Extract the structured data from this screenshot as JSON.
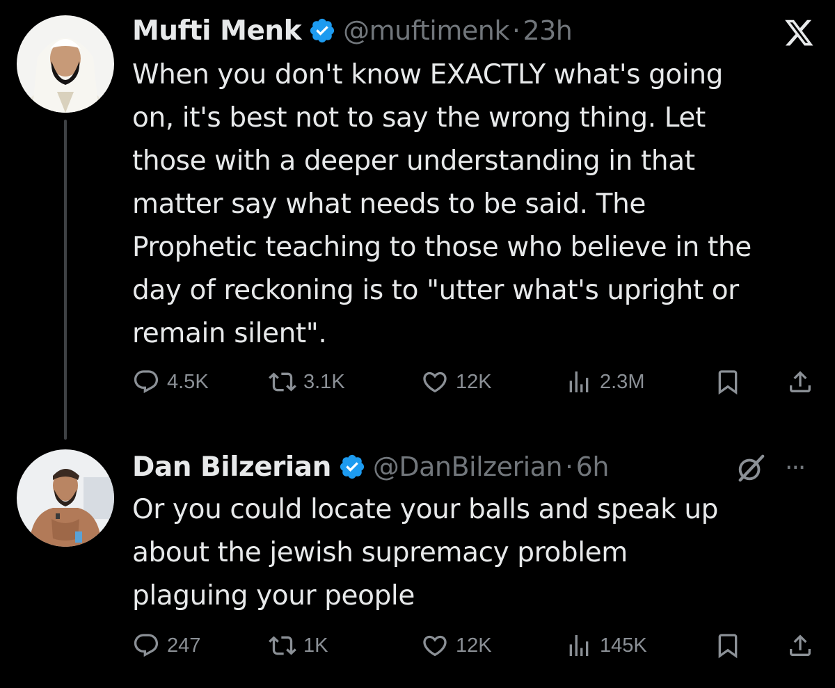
{
  "tweets": [
    {
      "display_name": "Mufti Menk",
      "handle": "@muftimenk",
      "separator": "·",
      "time": "23h",
      "text": "When you don't know EXACTLY what's going\non, it's best not to say the wrong thing. Let\nthose with a deeper understanding in that\nmatter say what needs to be said. The\nProphetic teaching to those who believe in the\nday of reckoning is to \"utter what's upright or\nremain silent\".",
      "stats": {
        "replies": "4.5K",
        "reposts": "3.1K",
        "likes": "12K",
        "views": "2.3M"
      }
    },
    {
      "display_name": "Dan Bilzerian",
      "handle": "@DanBilzerian",
      "separator": "·",
      "time": "6h",
      "more": "···",
      "text": "Or you could locate your balls and speak up\nabout the jewish supremacy problem\nplaguing your people",
      "stats": {
        "replies": "247",
        "reposts": "1K",
        "likes": "12K",
        "views": "145K"
      }
    }
  ],
  "icons": {
    "verified": "verified-badge-icon",
    "x_logo": "x-logo-icon",
    "grok": "grok-icon",
    "reply": "reply-icon",
    "repost": "repost-icon",
    "like": "heart-icon",
    "views": "views-icon",
    "bookmark": "bookmark-icon",
    "share": "share-icon"
  },
  "colors": {
    "background": "#000000",
    "text_primary": "#e7e9ea",
    "text_secondary": "#71767b",
    "verified_blue": "#1d9bf0",
    "thread_line": "#3e4144"
  }
}
